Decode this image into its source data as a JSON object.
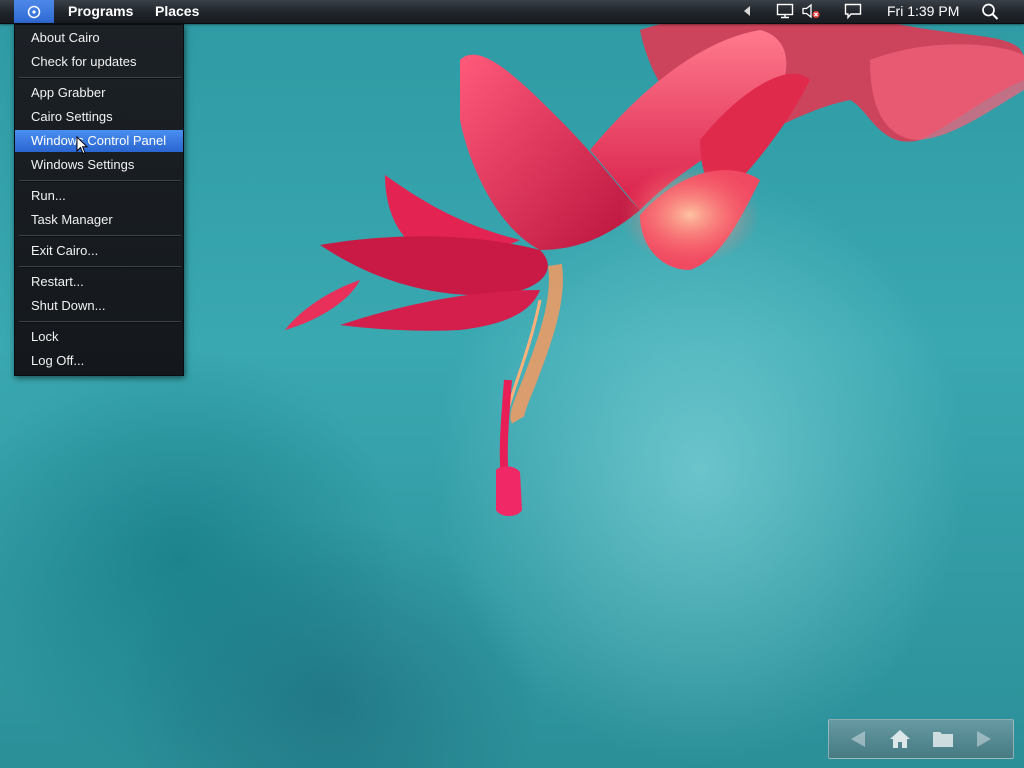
{
  "menubar": {
    "programs_label": "Programs",
    "places_label": "Places",
    "clock": "Fri 1:39 PM",
    "icons": [
      "cairo-logo-icon",
      "chevron-left-icon",
      "network-icon",
      "volume-muted-icon",
      "action-center-icon",
      "search-icon"
    ]
  },
  "cairo_menu": {
    "items": [
      {
        "label": "About Cairo"
      },
      {
        "label": "Check for updates"
      },
      {
        "label": "App Grabber"
      },
      {
        "label": "Cairo Settings"
      },
      {
        "label": "Windows Control Panel",
        "selected": true
      },
      {
        "label": "Windows Settings"
      },
      {
        "label": "Run..."
      },
      {
        "label": "Task Manager"
      },
      {
        "label": "Exit Cairo..."
      },
      {
        "label": "Restart..."
      },
      {
        "label": "Shut Down..."
      },
      {
        "label": "Lock"
      },
      {
        "label": "Log Off..."
      }
    ]
  },
  "nav_toolbar": {
    "icons": [
      "back-arrow-icon",
      "home-icon",
      "folder-icon",
      "forward-arrow-icon"
    ]
  },
  "colors": {
    "accent": "#3a78e0",
    "menu_bg": "#181c20",
    "desktop_bg": "#3aa8b1",
    "flower": "#e0244e"
  }
}
